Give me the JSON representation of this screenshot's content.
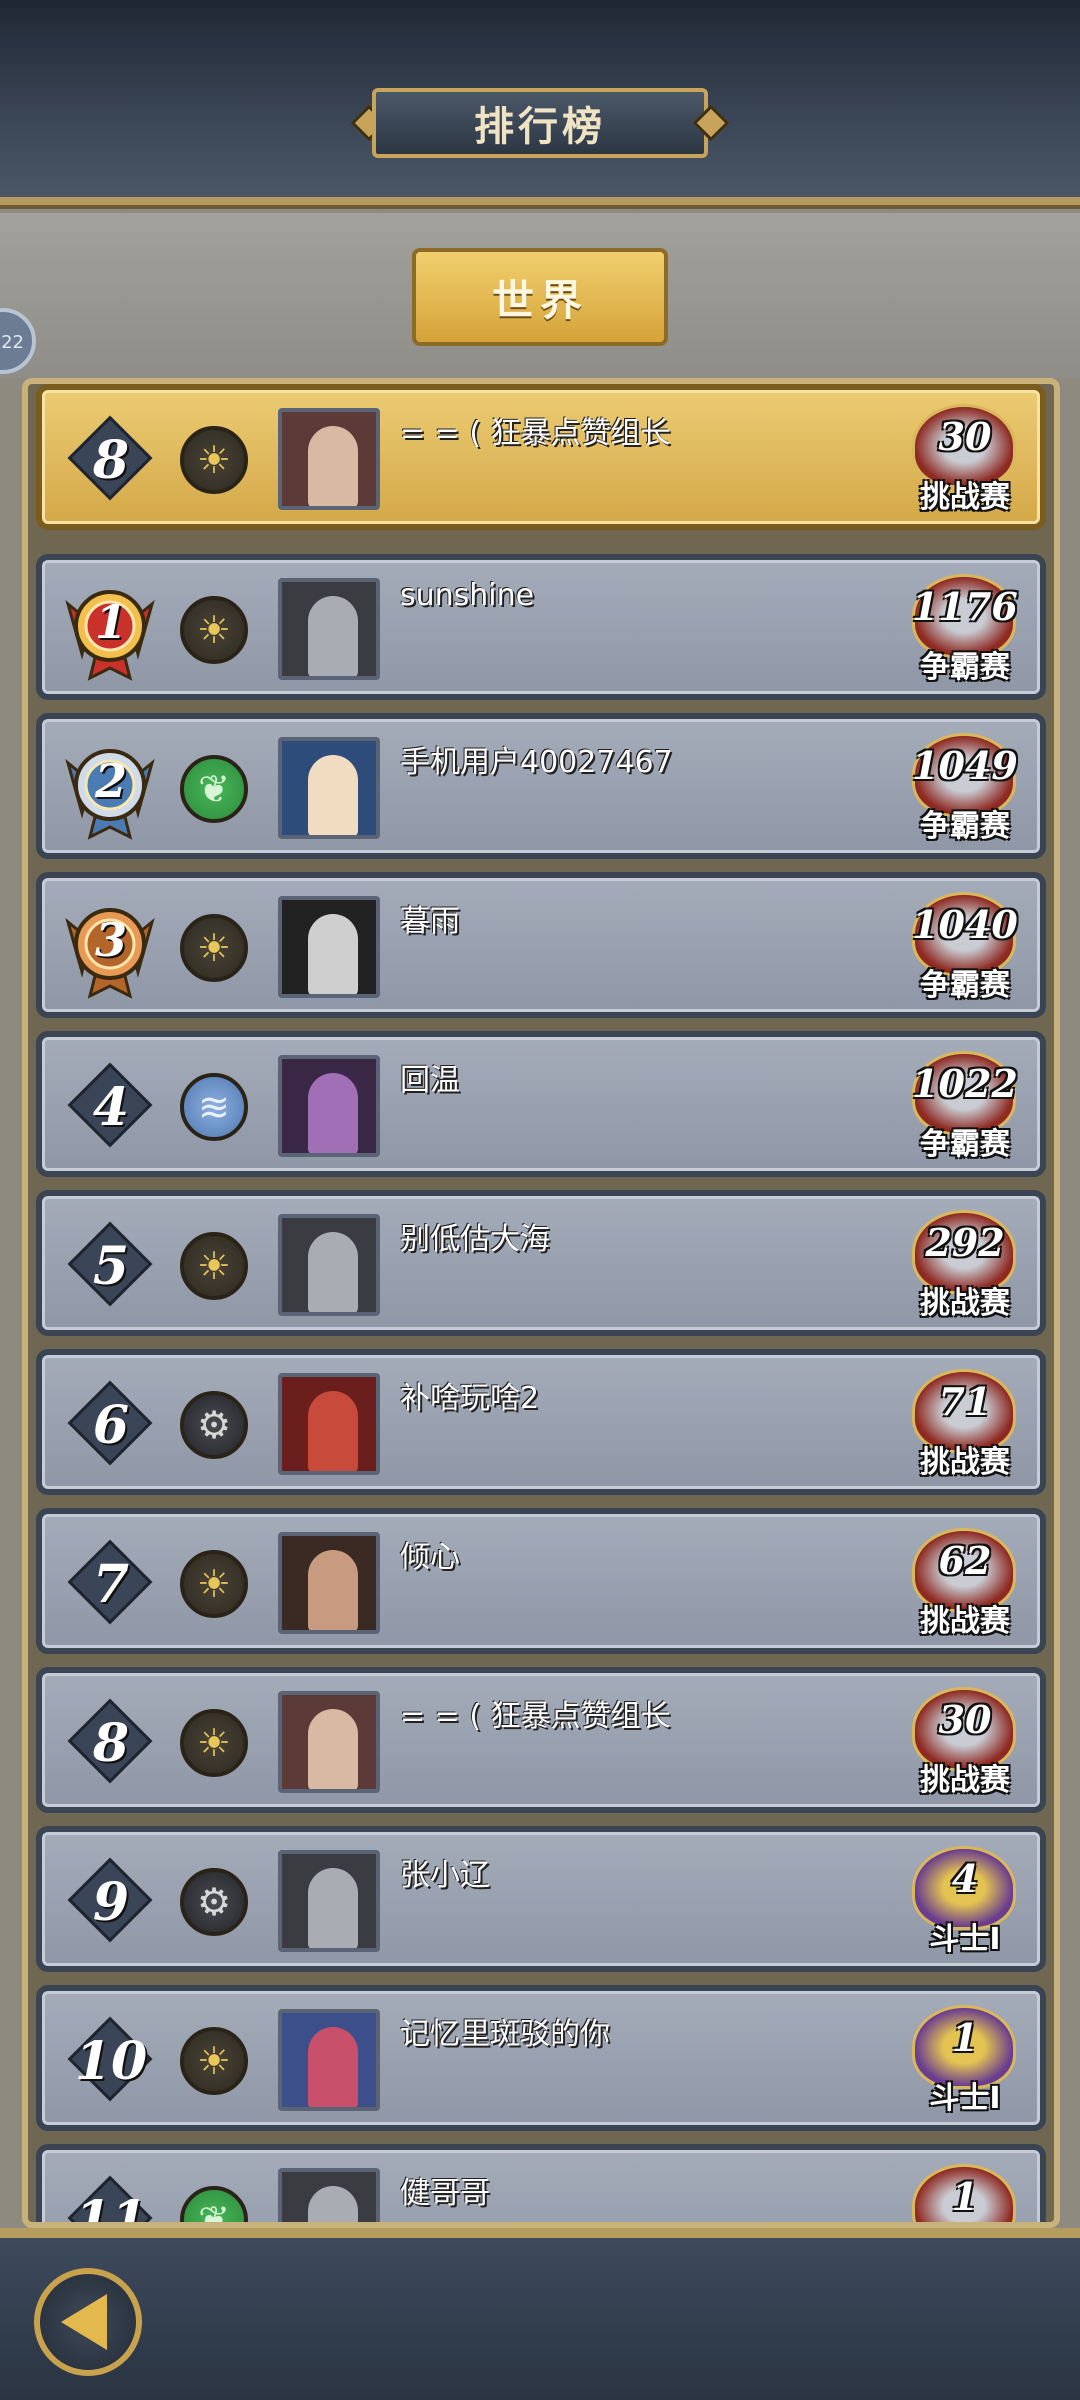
{
  "header": {
    "title": "排行榜"
  },
  "tabs": {
    "world": "世界"
  },
  "side_badge": "22",
  "my_entry": {
    "rank": "8",
    "element": "sun",
    "name": "= = ( 狂暴点赞组长",
    "score": "30",
    "mode": "挑战赛"
  },
  "rankings": [
    {
      "rank": "1",
      "element": "sun",
      "name": "sunshine",
      "score": "1176",
      "mode": "争霸赛"
    },
    {
      "rank": "2",
      "element": "leaf",
      "name": "手机用户40027467",
      "score": "1049",
      "mode": "争霸赛"
    },
    {
      "rank": "3",
      "element": "sun",
      "name": "暮雨",
      "score": "1040",
      "mode": "争霸赛"
    },
    {
      "rank": "4",
      "element": "wave",
      "name": "回温",
      "score": "1022",
      "mode": "争霸赛"
    },
    {
      "rank": "5",
      "element": "sun",
      "name": "别低估大海",
      "score": "292",
      "mode": "挑战赛"
    },
    {
      "rank": "6",
      "element": "gear",
      "name": "补啥玩啥2",
      "score": "71",
      "mode": "挑战赛"
    },
    {
      "rank": "7",
      "element": "sun",
      "name": "倾心",
      "score": "62",
      "mode": "挑战赛"
    },
    {
      "rank": "8",
      "element": "sun",
      "name": "= = ( 狂暴点赞组长",
      "score": "30",
      "mode": "挑战赛"
    },
    {
      "rank": "9",
      "element": "gear",
      "name": "张小辽",
      "score": "4",
      "mode": "斗士I"
    },
    {
      "rank": "10",
      "element": "sun",
      "name": "记忆里斑驳的你",
      "score": "1",
      "mode": "斗士I"
    },
    {
      "rank": "11",
      "element": "leaf",
      "name": "健哥哥",
      "score": "1",
      "mode": ""
    }
  ],
  "icons": {
    "sun": "☀",
    "leaf": "❦",
    "wave": "≋",
    "gear": "⚙",
    "back": "back-arrow-icon"
  },
  "colors": {
    "gold": "#c9a24e",
    "row_bg": "#9ba2b0",
    "highlight_row": "#e3bd5e"
  }
}
